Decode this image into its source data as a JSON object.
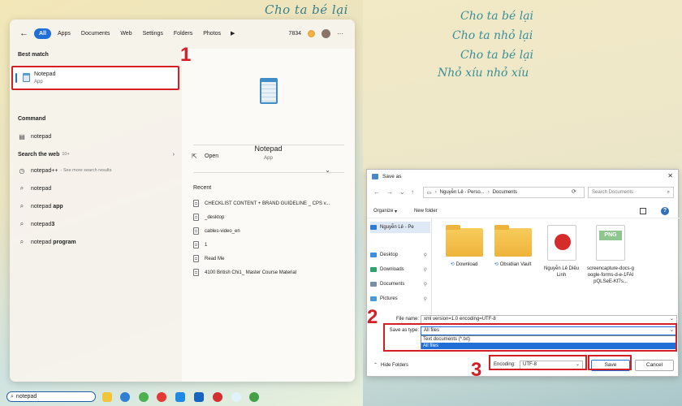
{
  "left": {
    "wallpaper_text": "Cho ta bé lại",
    "start_menu": {
      "filters": [
        "All",
        "Apps",
        "Documents",
        "Web",
        "Settings",
        "Folders",
        "Photos"
      ],
      "points": "7834",
      "best_match_heading": "Best match",
      "best_match": {
        "name": "Notepad",
        "type": "App"
      },
      "command_heading": "Command",
      "command_item": "notepad",
      "web_heading": "Search the web",
      "web_count": "10+",
      "web_items": [
        {
          "label": "notepad++",
          "suffix": "- See more search results",
          "icon": "history-icon"
        },
        {
          "pre": "notepad",
          "bold": "",
          "icon": "search-icon"
        },
        {
          "pre": "notepad ",
          "bold": "app",
          "icon": "search-icon"
        },
        {
          "pre": "notepad",
          "bold": "3",
          "icon": "search-icon"
        },
        {
          "pre": "notepad ",
          "bold": "program",
          "icon": "search-icon"
        }
      ],
      "detail": {
        "title": "Notepad",
        "subtitle": "App",
        "open_label": "Open",
        "recent_heading": "Recent",
        "recent_items": [
          "CHECKLIST CONTENT + BRAND GUIDELINE _ CPS v...",
          "_desktop",
          "cables-video_en",
          "1",
          "Read Me",
          "4100 British Chi1_ Master Course Material"
        ]
      }
    },
    "taskbar": {
      "search_value": "notepad"
    }
  },
  "annotations": {
    "one": "1",
    "two": "2",
    "three": "3"
  },
  "right": {
    "lyrics": [
      "Cho ta bé lại",
      "Cho ta nhỏ lại",
      "Cho ta bé lại",
      "Nhỏ xíu nhỏ xíu"
    ],
    "dialog": {
      "title": "Save as",
      "close": "✕",
      "address": [
        "Nguyễn Lê - Perso...",
        "Documents"
      ],
      "search_placeholder": "Search Documents",
      "organize": "Organize",
      "new_folder": "New folder",
      "help": "?",
      "nav_items": [
        {
          "label": "Nguyễn Lê - Pe",
          "color": "#2a7bd4",
          "pin": false
        },
        {
          "label": "Desktop",
          "color": "#3b8de0",
          "pin": true
        },
        {
          "label": "Downloads",
          "color": "#2fa36b",
          "pin": true
        },
        {
          "label": "Documents",
          "color": "#7a8fa6",
          "pin": true
        },
        {
          "label": "Pictures",
          "color": "#4b9bd8",
          "pin": true
        }
      ],
      "files": [
        {
          "label": "Download",
          "kind": "folder",
          "sync": true
        },
        {
          "label": "Obsidian Vault",
          "kind": "folder",
          "sync": true
        },
        {
          "label": "Nguyễn Lê Diệu Linh",
          "kind": "pdf"
        },
        {
          "label": "screencapture-docs-google-forms-d-e-1FAIpQLSeE-Kf7s...",
          "kind": "png",
          "badge": "PNG"
        }
      ],
      "file_name_label": "File name:",
      "file_name_value": "xml version=1.0 encoding=UTF-8",
      "save_type_label": "Save as type:",
      "save_type_value": "All files",
      "save_type_options": [
        "Text documents (*.txt)",
        "All files"
      ],
      "hide_folders": "Hide Folders",
      "encoding_label": "Encoding:",
      "encoding_value": "UTF-8",
      "save_label": "Save",
      "cancel_label": "Cancel"
    }
  }
}
